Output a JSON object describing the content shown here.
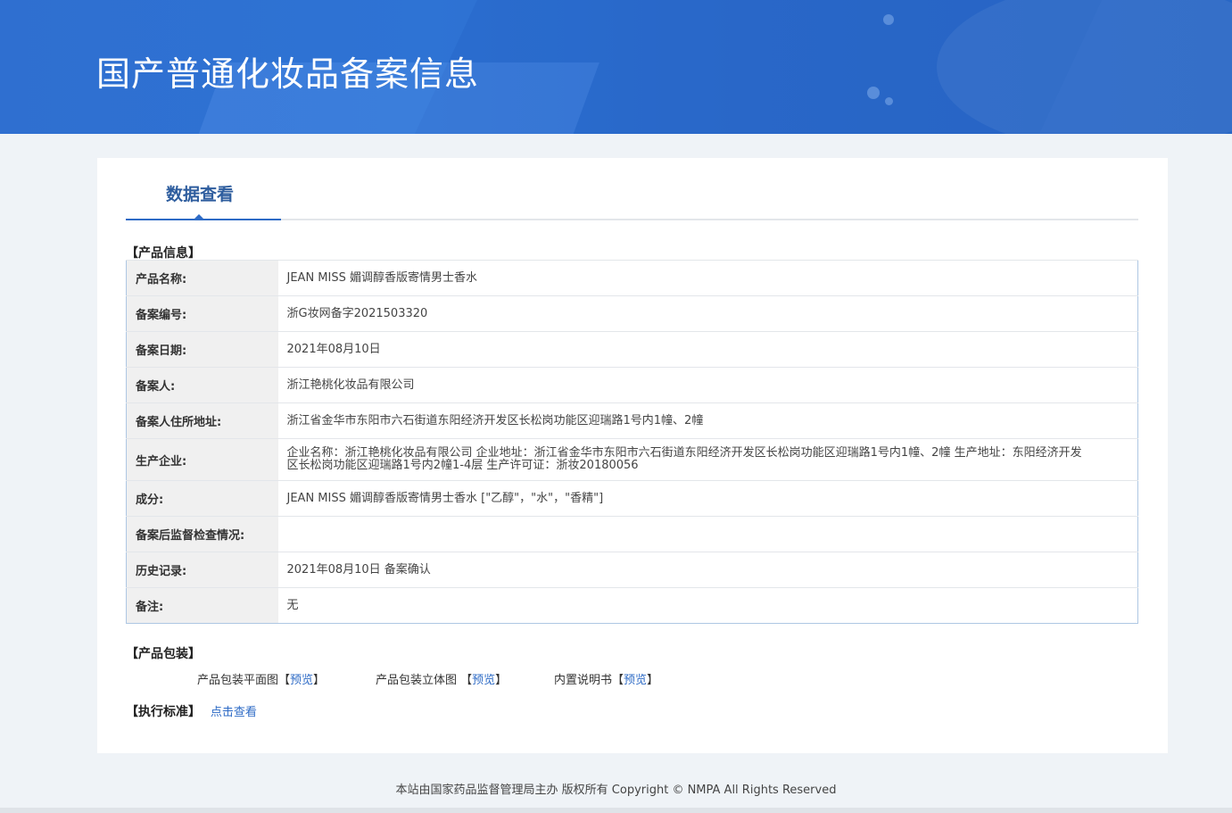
{
  "banner": {
    "title": "国产普通化妆品备案信息"
  },
  "tabs": [
    {
      "label": "数据查看",
      "active": true
    }
  ],
  "sections": {
    "product_info": "【产品信息】",
    "packaging": "【产品包装】",
    "standard": "【执行标准】"
  },
  "product_info": {
    "rows": [
      {
        "label": "产品名称:",
        "value": "JEAN MISS 媚调醇香版寄情男士香水"
      },
      {
        "label": "备案编号:",
        "value": "浙G妆网备字2021503320"
      },
      {
        "label": "备案日期:",
        "value": "2021年08月10日"
      },
      {
        "label": "备案人:",
        "value": "浙江艳桃化妆品有限公司"
      },
      {
        "label": "备案人住所地址:",
        "value": "浙江省金华市东阳市六石街道东阳经济开发区长松岗功能区迎瑞路1号内1幢、2幢"
      },
      {
        "label": "生产企业:",
        "value": "企业名称：浙江艳桃化妆品有限公司 企业地址：浙江省金华市东阳市六石街道东阳经济开发区长松岗功能区迎瑞路1号内1幢、2幢 生产地址：东阳经济开发区长松岗功能区迎瑞路1号内2幢1-4层 生产许可证：浙妆20180056"
      },
      {
        "label": "成分:",
        "value": "JEAN MISS 媚调醇香版寄情男士香水 [\"乙醇\"，\"水\"，\"香精\"]"
      },
      {
        "label": "备案后监督检查情况:",
        "value": ""
      },
      {
        "label": "历史记录:",
        "value": "2021年08月10日 备案确认"
      },
      {
        "label": "备注:",
        "value": "无"
      }
    ]
  },
  "packaging": {
    "items": [
      {
        "label": "产品包装平面图",
        "open": "【",
        "link": "预览",
        "close": "】"
      },
      {
        "label": "产品包装立体图 ",
        "open": "【",
        "link": "预览",
        "close": "】"
      },
      {
        "label": "内置说明书",
        "open": "【",
        "link": "预览",
        "close": "】"
      }
    ]
  },
  "standard": {
    "link": "点击查看"
  },
  "footer": {
    "text": "本站由国家药品监督管理局主办 版权所有 Copyright © NMPA All Rights Reserved"
  },
  "colors": {
    "banner": "#2f6fd0",
    "accent": "#2e6bc6",
    "label_bg": "#f0f0f0",
    "table_border": "#aec7e3"
  }
}
